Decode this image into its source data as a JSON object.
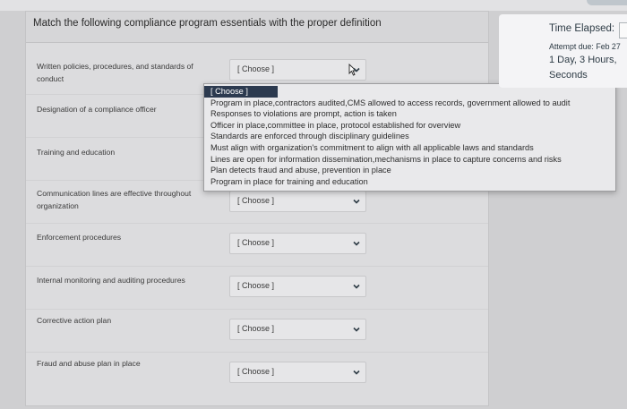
{
  "question": {
    "title": "Match the following compliance program essentials with the proper definition"
  },
  "rows": [
    {
      "prompt": "Written policies, procedures, and standards of conduct",
      "selected": "[ Choose ]"
    },
    {
      "prompt": "Designation of a compliance officer",
      "selected": "[ Choose ]"
    },
    {
      "prompt": "Training and education",
      "selected": "[ Choose ]"
    },
    {
      "prompt": "Communication lines are effective throughout organization",
      "selected": "[ Choose ]"
    },
    {
      "prompt": "Enforcement procedures",
      "selected": "[ Choose ]"
    },
    {
      "prompt": "Internal monitoring and auditing procedures",
      "selected": "[ Choose ]"
    },
    {
      "prompt": "Corrective action plan",
      "selected": "[ Choose ]"
    },
    {
      "prompt": "Fraud and abuse plan in place",
      "selected": "[ Choose ]"
    }
  ],
  "dropdown": {
    "options": [
      "[ Choose ]",
      "Program in place,contractors audited,CMS allowed to access records, government allowed to audit",
      "Responses to violations are prompt, action is taken",
      "Officer in place,committee in place, protocol established for overview",
      "Standards are enforced through disciplinary guidelines",
      "Must align with organization's commitment to align with all applicable laws and standards",
      "Lines are open for information dissemination,mechanisms in place to capture concerns and risks",
      "Plan detects fraud and abuse, prevention in place",
      "Program in place for training and education"
    ]
  },
  "timer": {
    "label": "Time Elapsed:",
    "attempt_due": "Attempt due: Feb 27",
    "time_value": "1 Day, 3 Hours,",
    "time_unit": "Seconds"
  },
  "icons": {
    "chevron": "chevron-down-icon",
    "cursor": "mouse-pointer-icon"
  }
}
